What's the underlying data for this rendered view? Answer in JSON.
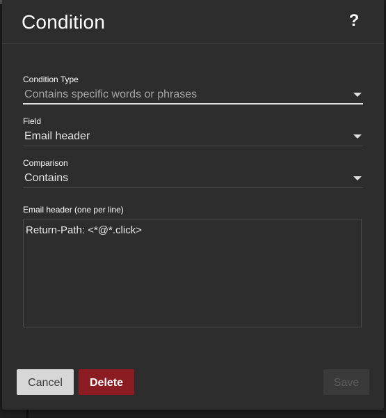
{
  "dialog": {
    "title": "Condition",
    "help_symbol": "?"
  },
  "fields": {
    "condition_type": {
      "label": "Condition Type",
      "value": "Contains specific words or phrases"
    },
    "field": {
      "label": "Field",
      "value": "Email header"
    },
    "comparison": {
      "label": "Comparison",
      "value": "Contains"
    }
  },
  "values_box": {
    "label": "Email header (one per line)",
    "text": "Return-Path: <*@*.click>"
  },
  "buttons": {
    "cancel": "Cancel",
    "delete": "Delete",
    "save": "Save"
  },
  "colors": {
    "dialog_bg": "#2d2d2d",
    "delete_bg": "#8b1d22",
    "cancel_bg": "#d7d7d7",
    "save_disabled_bg": "#3a3a3a"
  },
  "icons": {
    "help": "question-mark-icon",
    "dropdown": "caret-down-icon"
  }
}
